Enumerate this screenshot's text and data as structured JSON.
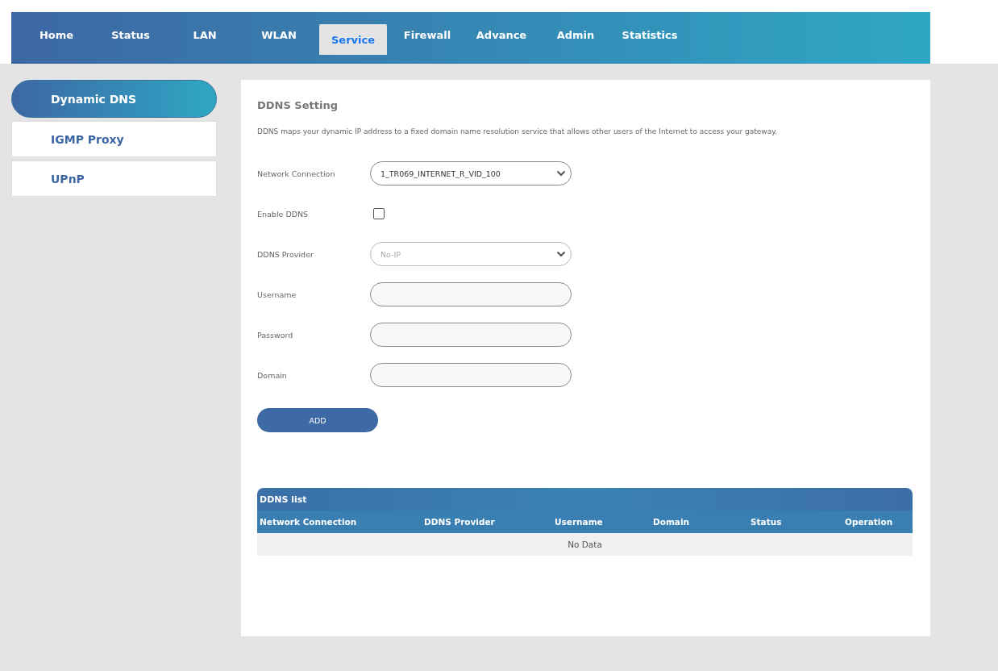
{
  "nav": {
    "tabs": [
      {
        "label": "Home",
        "selected": false
      },
      {
        "label": "Status",
        "selected": false
      },
      {
        "label": "LAN",
        "selected": false
      },
      {
        "label": "WLAN",
        "selected": false
      },
      {
        "label": "Service",
        "selected": true
      },
      {
        "label": "Firewall",
        "selected": false
      },
      {
        "label": "Advance",
        "selected": false
      },
      {
        "label": "Admin",
        "selected": false
      },
      {
        "label": "Statistics",
        "selected": false
      }
    ]
  },
  "sidebar": {
    "items": [
      {
        "label": "Dynamic DNS",
        "selected": true
      },
      {
        "label": "IGMP Proxy",
        "selected": false
      },
      {
        "label": "UPnP",
        "selected": false
      }
    ]
  },
  "form": {
    "title": "DDNS Setting",
    "description": "DDNS maps your dynamic IP address to a fixed domain name resolution service that allows other users of the Internet to access your gateway.",
    "fields": [
      {
        "kind": "select",
        "label": "Network Connection",
        "value": "1_TR069_INTERNET_R_VID_100",
        "disabled": false
      },
      {
        "kind": "checkbox",
        "label": "Enable DDNS",
        "checked": false
      },
      {
        "kind": "select",
        "label": "DDNS Provider",
        "value": "No-IP",
        "disabled": true
      },
      {
        "kind": "text",
        "label": "Username"
      },
      {
        "kind": "password",
        "label": "Password"
      },
      {
        "kind": "text",
        "label": "Domain"
      }
    ],
    "add_button": "ADD"
  },
  "table": {
    "title": "DDNS list",
    "columns": [
      "Network Connection",
      "DDNS Provider",
      "Username",
      "Domain",
      "Status",
      "Operation"
    ],
    "empty_text": "No Data"
  }
}
